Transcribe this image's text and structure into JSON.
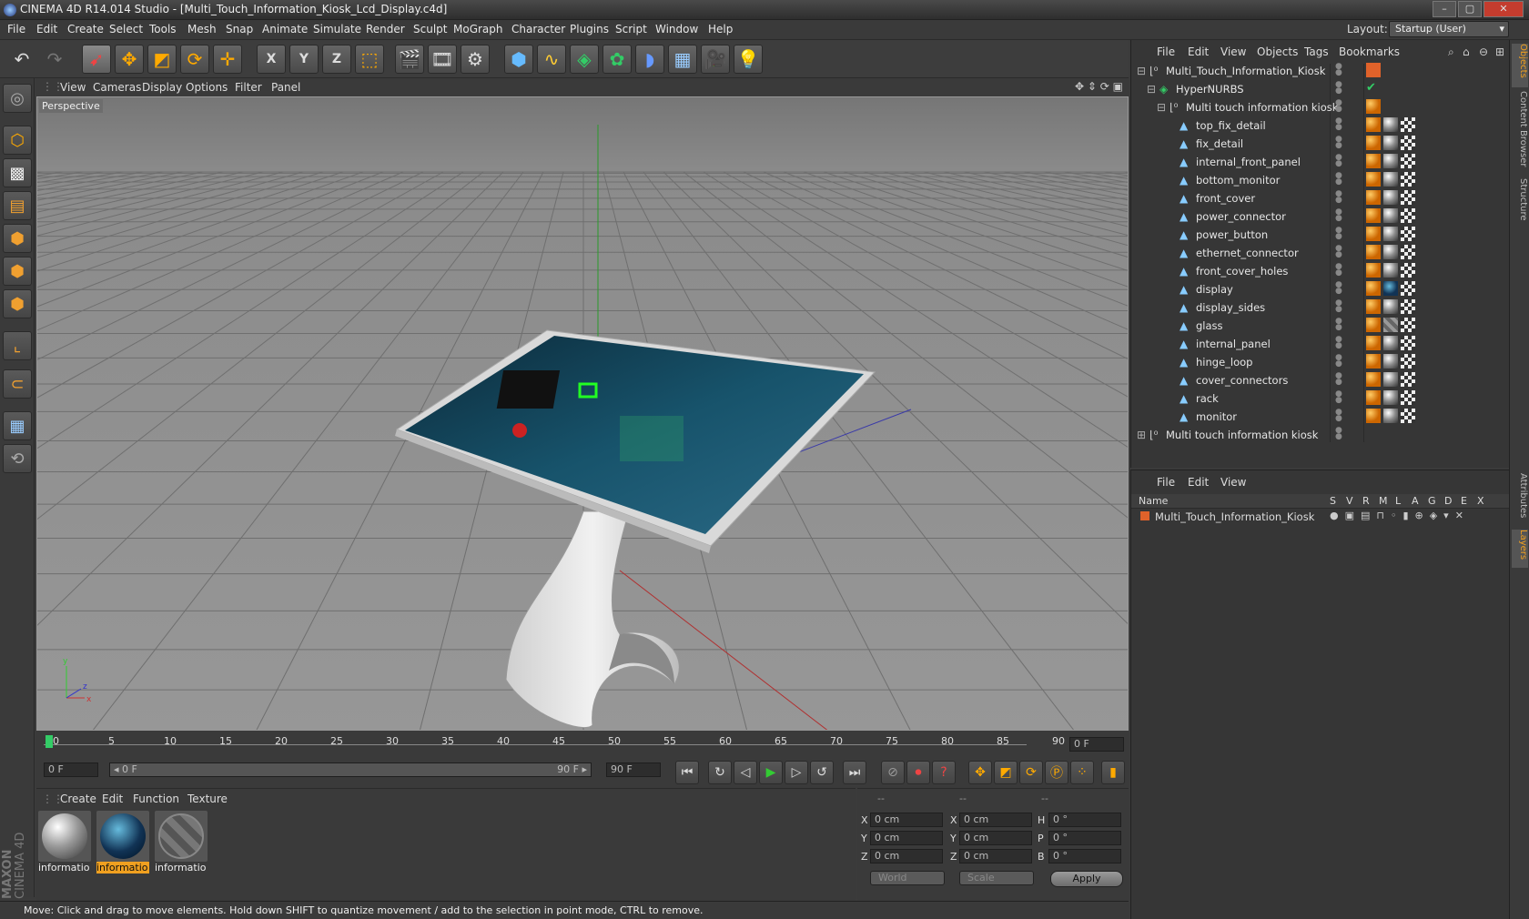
{
  "title": "CINEMA 4D R14.014 Studio - [Multi_Touch_Information_Kiosk_Lcd_Display.c4d]",
  "window_buttons": [
    "–",
    "▢",
    "✕"
  ],
  "menu": [
    "File",
    "Edit",
    "Create",
    "Select",
    "Tools",
    "Mesh",
    "Snap",
    "Animate",
    "Simulate",
    "Render",
    "Sculpt",
    "MoGraph",
    "Character",
    "Plugins",
    "Script",
    "Window",
    "Help"
  ],
  "layout": {
    "label": "Layout:",
    "value": "Startup (User)"
  },
  "toolbar_axes": [
    "X",
    "Y",
    "Z"
  ],
  "viewport": {
    "menu": [
      "View",
      "Cameras",
      "Display",
      "Options",
      "Filter",
      "Panel"
    ],
    "label": "Perspective",
    "nav_icons": "✥ ⇕ ⟳ ▣"
  },
  "timeline": {
    "ticks": [
      "0",
      "5",
      "10",
      "15",
      "20",
      "25",
      "30",
      "35",
      "40",
      "45",
      "50",
      "55",
      "60",
      "65",
      "70",
      "75",
      "80",
      "85",
      "90"
    ],
    "current_frame": "0 F",
    "start_field": "0 F",
    "range_start": "◂ 0 F",
    "range_end": "90 F ▸",
    "end_field": "90 F"
  },
  "materials": {
    "menu": [
      "Create",
      "Edit",
      "Function",
      "Texture"
    ],
    "items": [
      "informatio",
      "informatio",
      "informatio"
    ]
  },
  "coordinates": {
    "header": [
      "--",
      "--",
      "--"
    ],
    "rows": [
      {
        "a": "X",
        "v1": "0 cm",
        "b": "X",
        "v2": "0 cm",
        "c": "H",
        "v3": "0 °"
      },
      {
        "a": "Y",
        "v1": "0 cm",
        "b": "Y",
        "v2": "0 cm",
        "c": "P",
        "v3": "0 °"
      },
      {
        "a": "Z",
        "v1": "0 cm",
        "b": "Z",
        "v2": "0 cm",
        "c": "B",
        "v3": "0 °"
      }
    ],
    "mode1": "World",
    "mode2": "Scale",
    "apply": "Apply"
  },
  "status": "Move: Click and drag to move elements. Hold down SHIFT to quantize movement / add to the selection in point mode, CTRL to remove.",
  "objects_panel": {
    "menu": [
      "File",
      "Edit",
      "View",
      "Objects",
      "Tags",
      "Bookmarks"
    ],
    "tree": [
      {
        "name": "Multi_Touch_Information_Kiosk",
        "level": 0,
        "kind": "null",
        "tags": "orange"
      },
      {
        "name": "HyperNURBS",
        "level": 1,
        "kind": "nurbs",
        "tags": "check"
      },
      {
        "name": "Multi touch information kiosk",
        "level": 2,
        "kind": "null",
        "tags": "phong"
      },
      {
        "name": "top_fix_detail",
        "level": 3,
        "kind": "poly",
        "tags": "full"
      },
      {
        "name": "fix_detail",
        "level": 3,
        "kind": "poly",
        "tags": "full"
      },
      {
        "name": "internal_front_panel",
        "level": 3,
        "kind": "poly",
        "tags": "full"
      },
      {
        "name": "bottom_monitor",
        "level": 3,
        "kind": "poly",
        "tags": "full"
      },
      {
        "name": "front_cover",
        "level": 3,
        "kind": "poly",
        "tags": "full"
      },
      {
        "name": "power_connector",
        "level": 3,
        "kind": "poly",
        "tags": "full"
      },
      {
        "name": "power_button",
        "level": 3,
        "kind": "poly",
        "tags": "full"
      },
      {
        "name": "ethernet_connector",
        "level": 3,
        "kind": "poly",
        "tags": "full"
      },
      {
        "name": "front_cover_holes",
        "level": 3,
        "kind": "poly",
        "tags": "full"
      },
      {
        "name": "display",
        "level": 3,
        "kind": "poly",
        "tags": "screen"
      },
      {
        "name": "display_sides",
        "level": 3,
        "kind": "poly",
        "tags": "full"
      },
      {
        "name": "glass",
        "level": 3,
        "kind": "poly",
        "tags": "glass"
      },
      {
        "name": "internal_panel",
        "level": 3,
        "kind": "poly",
        "tags": "full"
      },
      {
        "name": "hinge_loop",
        "level": 3,
        "kind": "poly",
        "tags": "full"
      },
      {
        "name": "cover_connectors",
        "level": 3,
        "kind": "poly",
        "tags": "full"
      },
      {
        "name": "rack",
        "level": 3,
        "kind": "poly",
        "tags": "full"
      },
      {
        "name": "monitor",
        "level": 3,
        "kind": "poly",
        "tags": "full"
      },
      {
        "name": "Multi touch information kiosk",
        "level": 0,
        "kind": "null",
        "tags": "none"
      }
    ]
  },
  "layers_panel": {
    "menu": [
      "File",
      "Edit",
      "View"
    ],
    "columns": [
      "Name",
      "S",
      "V",
      "R",
      "M",
      "L",
      "A",
      "G",
      "D",
      "E",
      "X"
    ],
    "rows": [
      {
        "name": "Multi_Touch_Information_Kiosk",
        "color": "#e0622a"
      }
    ]
  },
  "side_tabs": [
    "Objects",
    "Content Browser",
    "Structure",
    "Attributes",
    "Layers"
  ],
  "brand": [
    "MAXON",
    "CINEMA 4D"
  ],
  "colors": {
    "accent": "#f0a020",
    "layer": "#e0622a"
  }
}
